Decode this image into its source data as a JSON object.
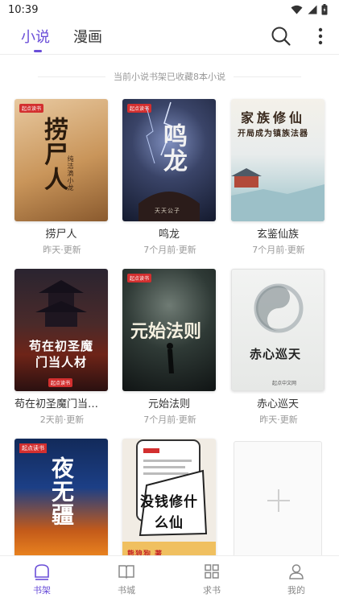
{
  "status_bar": {
    "time": "10:39"
  },
  "top_nav": {
    "tabs": [
      {
        "label": "小说",
        "active": true
      },
      {
        "label": "漫画",
        "active": false
      }
    ]
  },
  "shelf_info": "当前小说书架已收藏8本小说",
  "books": [
    {
      "title": "捞尸人",
      "updated": "昨天·更新",
      "cover_text": "捞尸人",
      "cover_sub": "纯洁滴小龙"
    },
    {
      "title": "鸣龙",
      "updated": "7个月前·更新",
      "cover_text": "鸣龙",
      "cover_sub": "天天公子"
    },
    {
      "title": "玄鉴仙族",
      "updated": "7个月前·更新",
      "cover_text": "家族修仙",
      "cover_sub": "开局成为镇族法器"
    },
    {
      "title": "苟在初圣魔门当人材",
      "updated": "2天前·更新",
      "cover_text": "苟在初圣魔门当人材",
      "cover_sub": ""
    },
    {
      "title": "元始法则",
      "updated": "7个月前·更新",
      "cover_text": "元始法则",
      "cover_sub": ""
    },
    {
      "title": "赤心巡天",
      "updated": "昨天·更新",
      "cover_text": "赤心巡天",
      "cover_sub": "起点中文网"
    },
    {
      "title": "",
      "updated": "",
      "cover_text": "夜无疆",
      "cover_sub": "起点读书"
    },
    {
      "title": "",
      "updated": "",
      "cover_text": "没钱修什么仙",
      "cover_sub": "熊狼狗 著"
    }
  ],
  "cover_badge": "起点读书",
  "bottom_nav": [
    {
      "label": "书架",
      "icon": "shelf-icon",
      "active": true
    },
    {
      "label": "书城",
      "icon": "book-icon",
      "active": false
    },
    {
      "label": "求书",
      "icon": "grid-icon",
      "active": false
    },
    {
      "label": "我的",
      "icon": "person-icon",
      "active": false
    }
  ],
  "colors": {
    "accent": "#6a4ed8"
  }
}
